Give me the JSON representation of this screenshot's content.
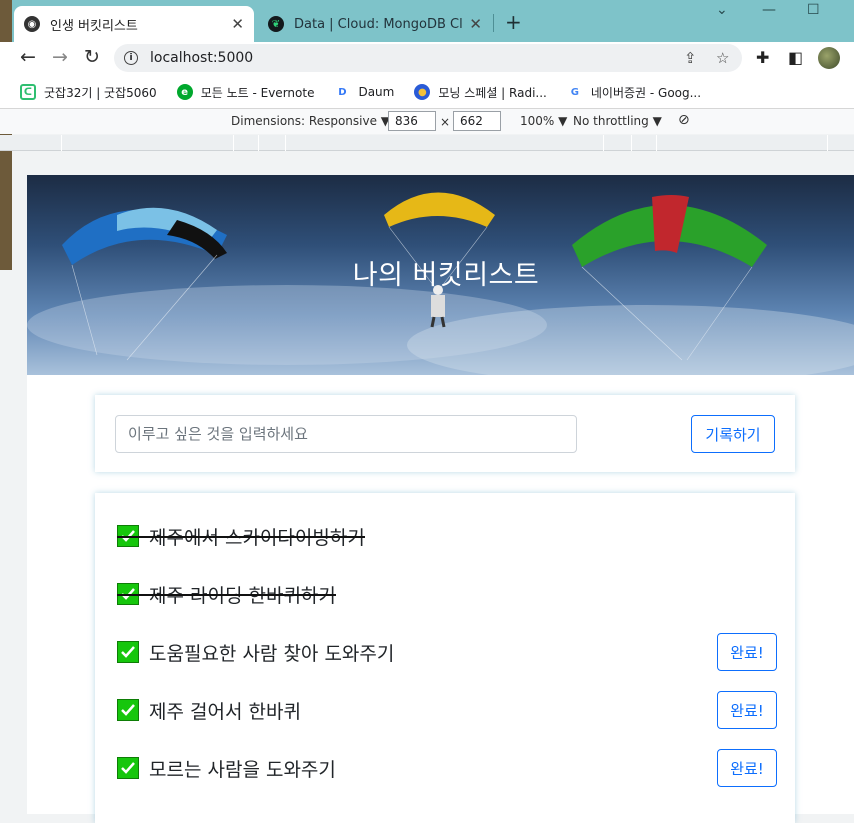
{
  "browser": {
    "tabs": [
      {
        "title": "인생 버킷리스트",
        "active": true
      },
      {
        "title": "Data | Cloud: MongoDB Cloud",
        "active": false
      }
    ],
    "new_tab": "+",
    "url": "localhost:5000",
    "bookmarks": [
      {
        "label": "굿잡32기 | 굿잡5060",
        "icon": "goodjob-icon",
        "color": "#2fbf71"
      },
      {
        "label": "모든 노트 - Evernote",
        "icon": "evernote-icon",
        "color": "#00a82d"
      },
      {
        "label": "Daum",
        "icon": "daum-icon",
        "color": "#3478f6"
      },
      {
        "label": "모닝 스페셜 | Radi...",
        "icon": "radio-icon",
        "color": "#e8a23c"
      },
      {
        "label": "네이버증권 - Goog...",
        "icon": "google-icon",
        "color": "#4285f4"
      }
    ]
  },
  "devtools": {
    "dimensions_label": "Dimensions: Responsive",
    "width": "836",
    "times": "×",
    "height": "662",
    "zoom": "100%",
    "throttling": "No throttling"
  },
  "page": {
    "hero_title": "나의 버킷리스트",
    "input_placeholder": "이루고 싶은 것을 입력하세요",
    "record_button": "기록하기",
    "done_label": "완료!",
    "goals": [
      {
        "text": "제주에서 스카이다이빙하기",
        "done": true
      },
      {
        "text": "제주 라이딩 한바퀴하기",
        "done": true
      },
      {
        "text": "도움필요한 사람 찾아 도와주기",
        "done": false
      },
      {
        "text": "제주 걸어서 한바퀴",
        "done": false
      },
      {
        "text": "모르는 사람을 도와주기",
        "done": false
      }
    ]
  },
  "colors": {
    "accent": "#0d6efd",
    "check_green": "#16c60c",
    "titlebar": "#7ec3c9"
  }
}
